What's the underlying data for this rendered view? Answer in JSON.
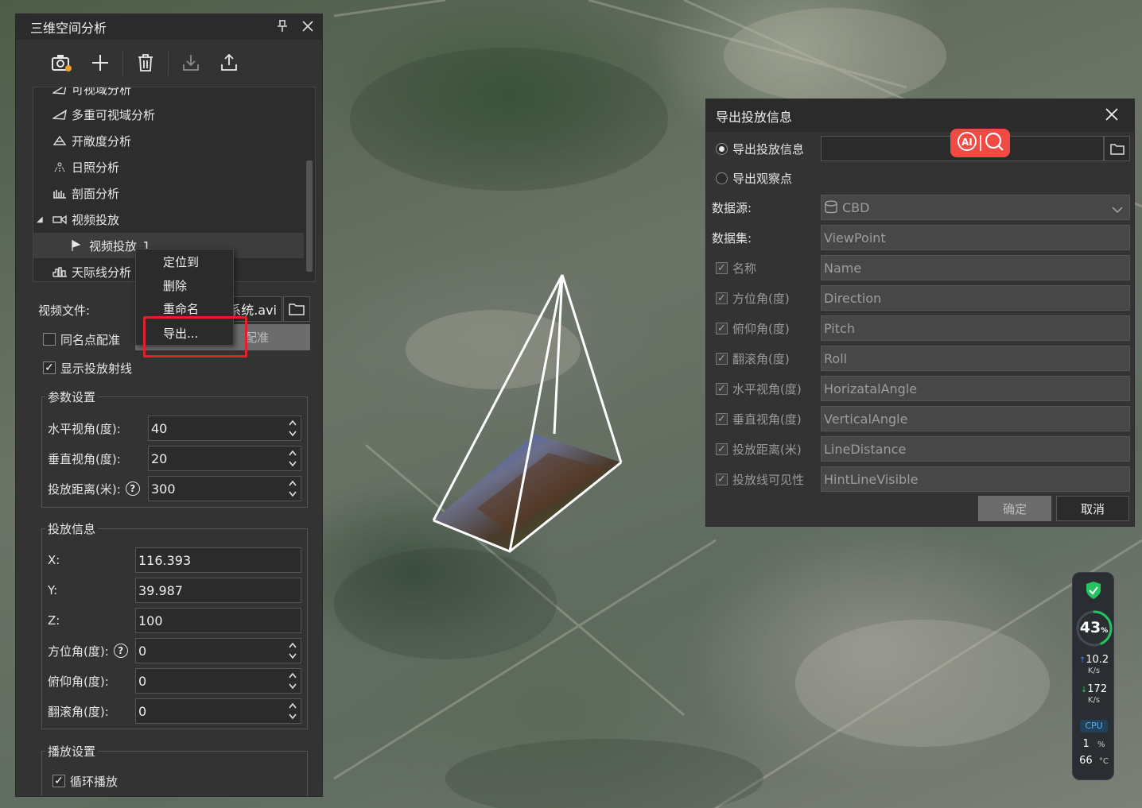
{
  "left_panel": {
    "title": "三维空间分析",
    "tree_items": [
      {
        "label": "可视域分析",
        "icon": "viewshed-icon"
      },
      {
        "label": "多重可视域分析",
        "icon": "multi-viewshed-icon"
      },
      {
        "label": "开敞度分析",
        "icon": "openness-icon"
      },
      {
        "label": "日照分析",
        "icon": "sunlight-icon"
      },
      {
        "label": "剖面分析",
        "icon": "profile-icon"
      },
      {
        "label": "视频投放",
        "icon": "video-projection-icon",
        "expanded": true
      },
      {
        "label": "视频投放_1",
        "icon": "flag-icon",
        "selected": true
      },
      {
        "label": "天际线分析",
        "icon": "skyline-icon"
      }
    ],
    "video_file_label": "视频文件:",
    "video_file_value": "系统.avi",
    "same_point_label": "同名点配准",
    "register_button": "配准",
    "show_rays_label": "显示投放射线",
    "params_group": "参数设置",
    "h_fov_label": "水平视角(度):",
    "h_fov_value": "40",
    "v_fov_label": "垂直视角(度):",
    "v_fov_value": "20",
    "distance_label": "投放距离(米):",
    "distance_value": "300",
    "info_group": "投放信息",
    "x_label": "X:",
    "x_value": "116.393",
    "y_label": "Y:",
    "y_value": "39.987",
    "z_label": "Z:",
    "z_value": "100",
    "azimuth_label": "方位角(度):",
    "azimuth_value": "0",
    "pitch_label": "俯仰角(度):",
    "pitch_value": "0",
    "roll_label": "翻滚角(度):",
    "roll_value": "0",
    "play_group": "播放设置",
    "loop_label": "循环播放"
  },
  "context_menu": {
    "items": [
      "定位到",
      "删除",
      "重命名",
      "导出..."
    ]
  },
  "export_dialog": {
    "title": "导出投放信息",
    "radio_export_info": "导出投放信息",
    "radio_export_view": "导出观察点",
    "datasource_label": "数据源:",
    "datasource_value": "CBD",
    "dataset_label": "数据集:",
    "dataset_value": "ViewPoint",
    "fields": [
      {
        "label": "名称",
        "value": "Name"
      },
      {
        "label": "方位角(度)",
        "value": "Direction"
      },
      {
        "label": "俯仰角(度)",
        "value": "Pitch"
      },
      {
        "label": "翻滚角(度)",
        "value": "Roll"
      },
      {
        "label": "水平视角(度)",
        "value": "HorizatalAngle"
      },
      {
        "label": "垂直视角(度)",
        "value": "VerticalAngle"
      },
      {
        "label": "投放距离(米)",
        "value": "LineDistance"
      },
      {
        "label": "投放线可见性",
        "value": "HintLineVisible"
      }
    ],
    "ok_button": "确定",
    "cancel_button": "取消"
  },
  "monitor": {
    "percent": "43",
    "percent_unit": "%",
    "up_speed": "10.2",
    "up_unit": "K/s",
    "down_speed": "172",
    "down_unit": "K/s",
    "cpu_label": "CPU",
    "cpu_value": "1",
    "cpu_unit": "%",
    "temp_value": "66",
    "temp_unit": "°C"
  }
}
